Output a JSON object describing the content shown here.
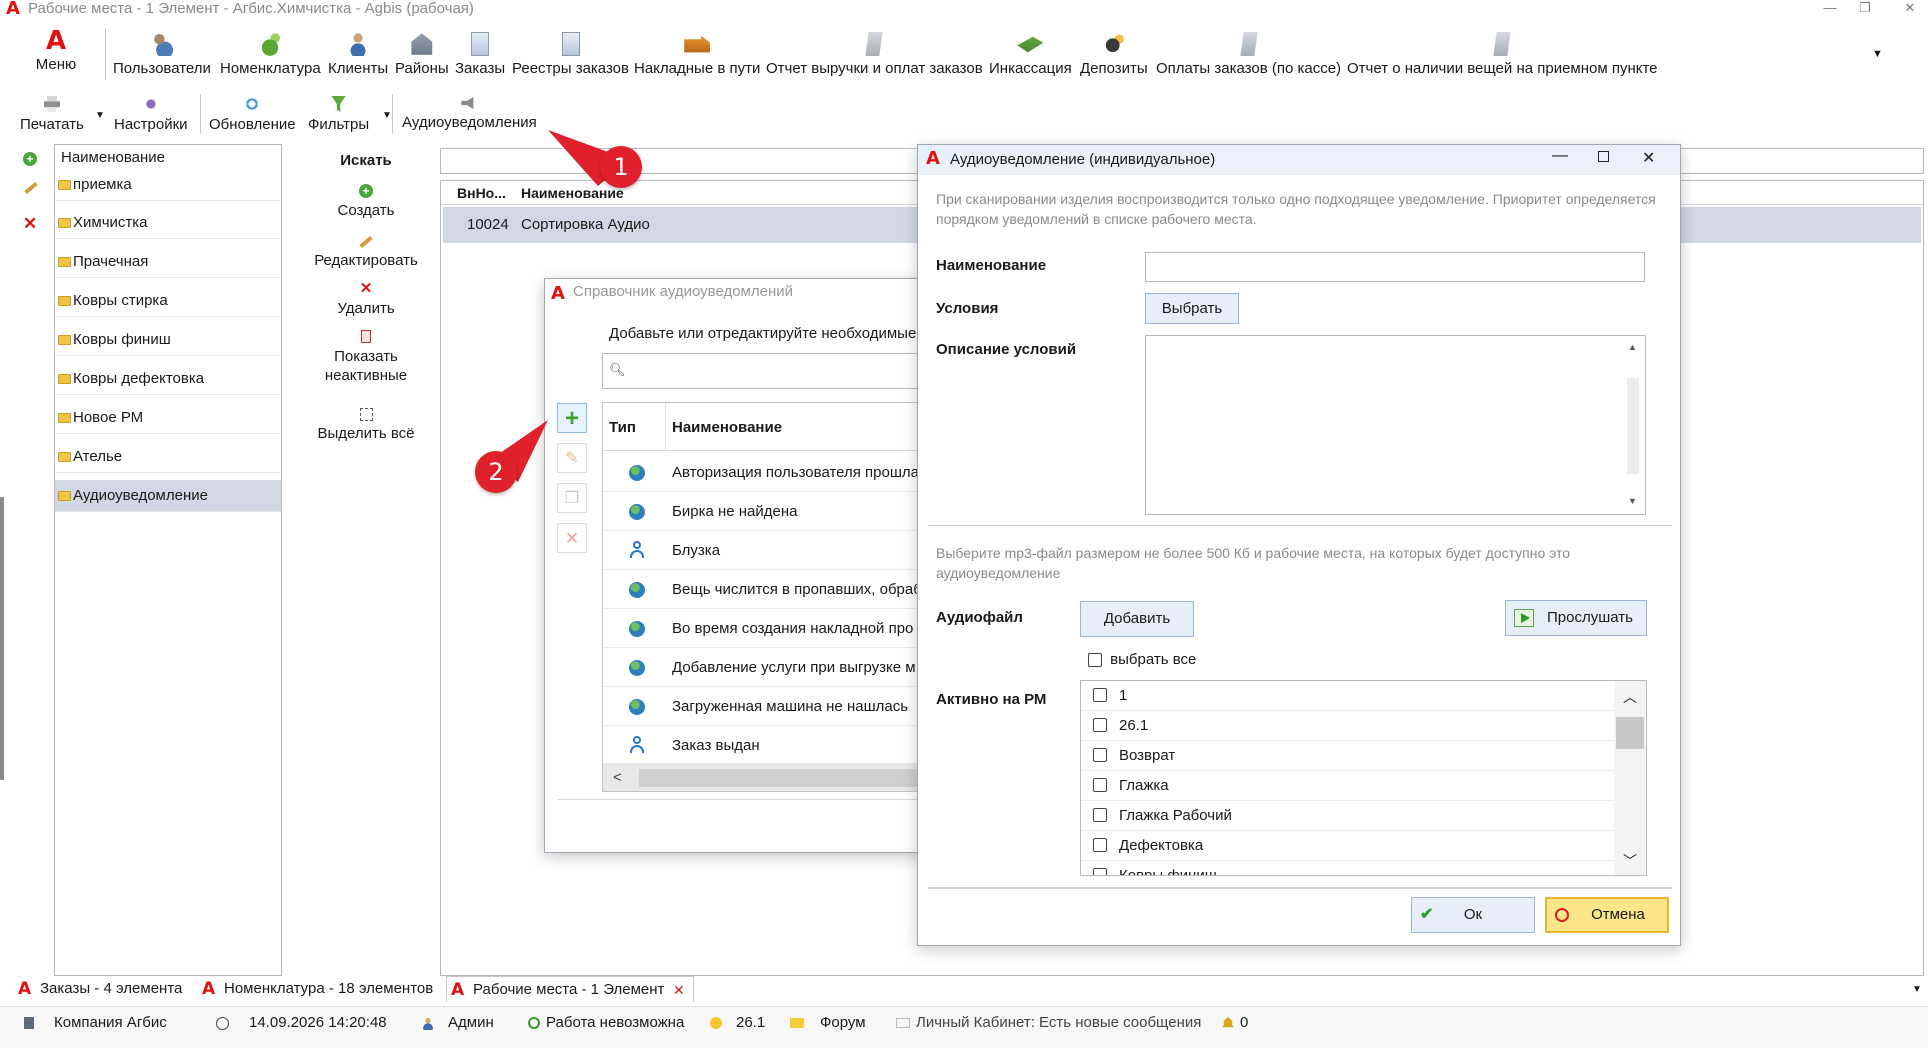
{
  "window": {
    "title": "Рабочие места - 1 Элемент - Агбис.Химчистка - Agbis (рабочая)"
  },
  "ribbon": {
    "menu_label": "Меню",
    "items": [
      {
        "label": "Пользователи",
        "icon": "users-icon"
      },
      {
        "label": "Номенклатура",
        "icon": "nomenclature-icon"
      },
      {
        "label": "Клиенты",
        "icon": "clients-icon"
      },
      {
        "label": "Районы",
        "icon": "regions-icon"
      },
      {
        "label": "Заказы",
        "icon": "orders-icon"
      },
      {
        "label": "Реестры заказов",
        "icon": "order-registers-icon"
      },
      {
        "label": "Накладные в пути",
        "icon": "truck-icon"
      },
      {
        "label": "Отчет выручки и оплат заказов",
        "icon": "report-icon"
      },
      {
        "label": "Инкассация",
        "icon": "cash-icon"
      },
      {
        "label": "Депозиты",
        "icon": "deposit-icon"
      },
      {
        "label": "Оплаты заказов (по кассе)",
        "icon": "payments-icon"
      },
      {
        "label": "Отчет о наличии вещей на приемном пункте",
        "icon": "stock-report-icon"
      }
    ],
    "row2": {
      "print": "Печатать",
      "settings": "Настройки",
      "refresh": "Обновление",
      "filters": "Фильтры",
      "audio": "Аудиоуведомления"
    }
  },
  "tree": {
    "header": "Наименование",
    "items": [
      "приемка",
      "Химчистка",
      "Прачечная",
      "Ковры стирка",
      "Ковры финиш",
      "Ковры дефектовка",
      "Новое РМ",
      "Ателье",
      "Аудиоуведомление"
    ],
    "selected_index": 8
  },
  "actions": {
    "search": "Искать",
    "create": "Создать",
    "edit": "Редактировать",
    "delete": "Удалить",
    "show_inactive_1": "Показать",
    "show_inactive_2": "неактивные",
    "select_all": "Выделить всё"
  },
  "grid": {
    "col_id": "ВнНо...",
    "col_name": "Наименование",
    "rows": [
      {
        "id": "10024",
        "name": "Сортировка Аудио"
      }
    ]
  },
  "directory": {
    "title": "Справочник аудиоуведомлений",
    "hint": "Добавьте или отредактируйте необходимые",
    "col_type": "Тип",
    "col_name": "Наименование",
    "rows": [
      {
        "type": "globe",
        "name": "Авторизация пользователя прошла"
      },
      {
        "type": "globe",
        "name": "Бирка не найдена"
      },
      {
        "type": "person",
        "name": "Блузка"
      },
      {
        "type": "globe",
        "name": "Вещь числится в пропавших, обраб"
      },
      {
        "type": "globe",
        "name": "Во время создания накладной про"
      },
      {
        "type": "globe",
        "name": "Добавление услуги при выгрузке м"
      },
      {
        "type": "globe",
        "name": "Загруженная машина не нашлась"
      },
      {
        "type": "person",
        "name": "Заказ выдан"
      }
    ]
  },
  "dialog": {
    "title": "Аудиоуведомление (индивидуальное)",
    "info": "При сканировании изделия воспроизводится только одно подходящее уведомление. Приоритет определяется порядком уведомлений в списке рабочего места.",
    "name_label": "Наименование",
    "name_value": "",
    "conditions_label": "Условия",
    "choose_button": "Выбрать",
    "conditions_desc_label": "Описание условий",
    "mp3_hint": "Выберите mp3-файл размером не более 500 Кб и рабочие места, на которых будет доступно это аудиоуведомление",
    "audiofile_label": "Аудиофайл",
    "add_button": "Добавить",
    "listen_button": "Прослушать",
    "select_all": "выбрать все",
    "active_label": "Активно на РМ",
    "workplaces": [
      "1",
      "26.1",
      "Возврат",
      "Глажка",
      "Глажка Рабочий",
      "Дефектовка",
      "Ковры финиш"
    ],
    "ok": "Ок",
    "cancel": "Отмена"
  },
  "annotations": {
    "marker1": "1",
    "marker2": "2"
  },
  "tabs": [
    {
      "label": "Заказы - 4 элемента"
    },
    {
      "label": "Номенклатура - 18 элементов"
    },
    {
      "label": "Рабочие места - 1 Элемент"
    }
  ],
  "status": {
    "company": "Компания Агбис",
    "datetime": "14.09.2026 14:20:48",
    "user": "Админ",
    "work_status": "Работа невозможна",
    "workplace": "26.1",
    "forum": "Форум",
    "cabinet": "Личный Кабинет: Есть новые сообщения",
    "notifications": "0"
  },
  "colors": {
    "accent_red": "#e01010",
    "selection": "#d0d9e3",
    "marker_red": "#e0202a",
    "cancel_yellow": "#fde68a"
  }
}
